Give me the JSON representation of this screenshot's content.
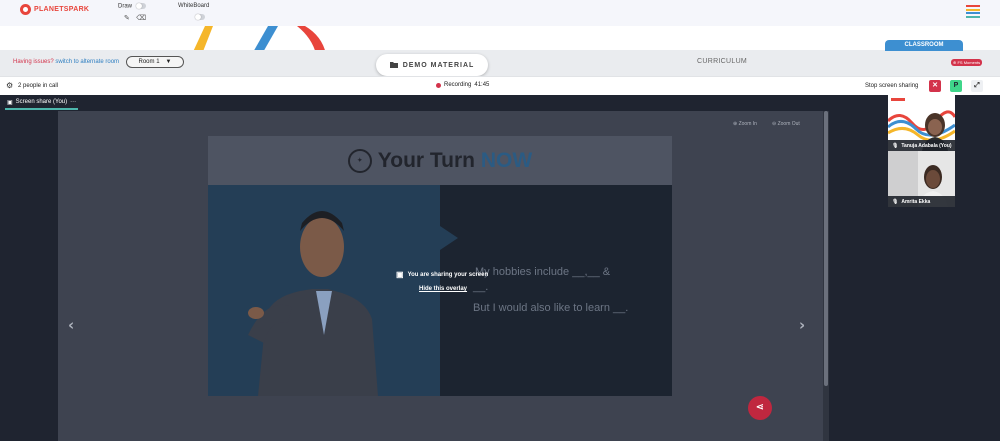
{
  "app": {
    "logo_text": "PLANETSPARK"
  },
  "toolbar": {
    "draw_label": "Draw",
    "whiteboard_label": "WhiteBoard"
  },
  "roombar": {
    "issues_text": "Having issues?",
    "alternate_link": "switch to alternate room",
    "room_selected": "Room 1",
    "demo_material_label": "DEMO MATERIAL",
    "curriculum_label": "CURRICULUM",
    "classroom_tab": "CLASSROOM",
    "moments_badge": "FS Moments"
  },
  "call": {
    "people_count": "2 people in call",
    "recording_label": "Recording",
    "recording_time": "41:45",
    "stop_sharing_label": "Stop screen sharing",
    "close_btn": "✕",
    "p_btn": "P",
    "expand_btn": "⤢"
  },
  "stage": {
    "share_tab_label": "Screen share (You)",
    "share_tab_more": "···",
    "zoom_in": "Zoom In",
    "zoom_out": "Zoom Out"
  },
  "slide": {
    "title_part1": "Your Turn",
    "title_part2": "NOW",
    "line1": "My hobbies include __,__ &",
    "line1_tail": "__.",
    "line2": "But I would also like to learn __."
  },
  "overlay": {
    "sharing_text": "You are sharing your screen",
    "hide_link": "Hide this overlay"
  },
  "participants": [
    {
      "name": "Tanuja Adabala (You)"
    },
    {
      "name": "Amrita Ekka"
    }
  ],
  "colors": {
    "brand_red": "#d3334b",
    "link_blue": "#2f7fc1",
    "classroom_blue": "#3d8fd1",
    "stage_dark": "#1f2430",
    "accent_teal": "#4db6ac"
  }
}
